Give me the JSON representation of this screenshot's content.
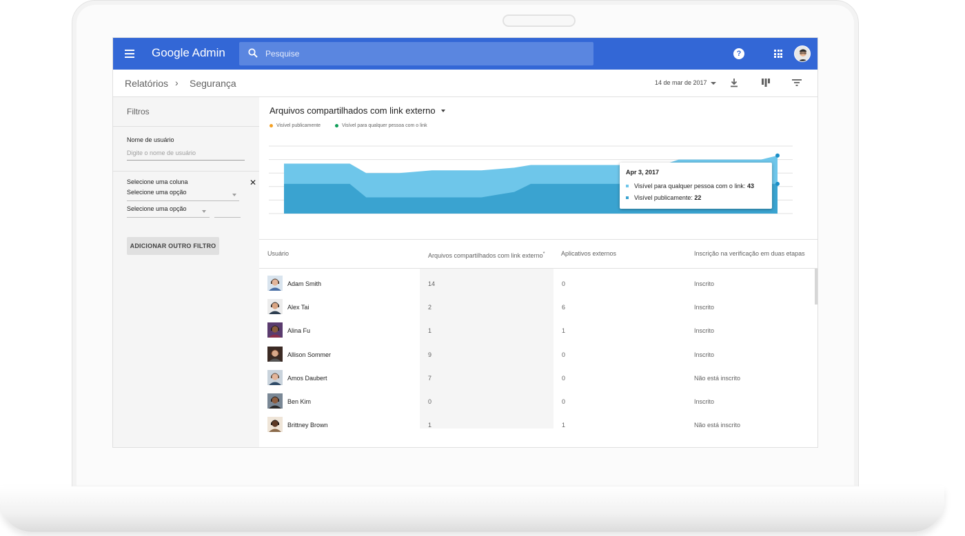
{
  "appbar": {
    "brand_google": "Google",
    "brand_admin": "Admin",
    "search_placeholder": "Pesquise",
    "help_glyph": "?"
  },
  "breadcrumb": {
    "items": [
      "Relatórios",
      "Segurança"
    ],
    "separator": "›"
  },
  "toolbar": {
    "date": "14 de mar de 2017"
  },
  "sidebar": {
    "title": "Filtros",
    "username_label": "Nome de usuário",
    "username_placeholder": "Digite o nome de usuário",
    "column_label": "Selecione uma coluna",
    "select1": "Selecione uma opção",
    "select2": "Selecione uma opção",
    "close_glyph": "✕",
    "add_filter": "ADICIONAR OUTRO FILTRO"
  },
  "chart_data": {
    "type": "area",
    "title": "Arquivos compartilhados com link externo",
    "series": [
      {
        "name": "Visível publicamente",
        "color": "#f4a024",
        "values": [
          22,
          22,
          22,
          22,
          22,
          12,
          12,
          12,
          12,
          12,
          12,
          12,
          12,
          14,
          16,
          22,
          22,
          22,
          22,
          22,
          22,
          22,
          22,
          22,
          22,
          22,
          22,
          22,
          22,
          22,
          22
        ]
      },
      {
        "name": "Visível para qualquer pessoa com o link",
        "color": "#0f9d58",
        "values": [
          37,
          37,
          37,
          37,
          37,
          30,
          30,
          30,
          31,
          32,
          32,
          32,
          32,
          33,
          34,
          36,
          36,
          36,
          36,
          36,
          36,
          36,
          36,
          36,
          40,
          40,
          40,
          40,
          40,
          40,
          43
        ]
      }
    ],
    "ylim": [
      0,
      50
    ],
    "grid": true,
    "legend": "top-left",
    "area_colors": {
      "upper": "#6ec6ea",
      "lower": "#3aa3d0"
    },
    "tooltip": {
      "date": "Apr 3, 2017",
      "row1_label": "Visível para qualquer pessoa com o link:",
      "row1_value": "43",
      "row2_label": "Visível publicamente:",
      "row2_value": "22"
    }
  },
  "table": {
    "headers": [
      "Usuário",
      "Arquivos compartilhados com link externo",
      "Aplicativos externos",
      "Inscrição na verificação em duas etapas"
    ],
    "header_note": "*",
    "rows": [
      {
        "name": "Adam Smith",
        "files": "14",
        "apps": "0",
        "status": "Inscrito"
      },
      {
        "name": "Alex Tai",
        "files": "2",
        "apps": "6",
        "status": "Inscrito"
      },
      {
        "name": "Alina Fu",
        "files": "1",
        "apps": "1",
        "status": "Inscrito"
      },
      {
        "name": "Allison Sommer",
        "files": "9",
        "apps": "0",
        "status": "Inscrito"
      },
      {
        "name": "Amos Daubert",
        "files": "7",
        "apps": "0",
        "status": "Não está inscrito"
      },
      {
        "name": "Ben Kim",
        "files": "0",
        "apps": "0",
        "status": "Inscrito"
      },
      {
        "name": "Brittney Brown",
        "files": "1",
        "apps": "1",
        "status": "Não está inscrito"
      }
    ]
  }
}
